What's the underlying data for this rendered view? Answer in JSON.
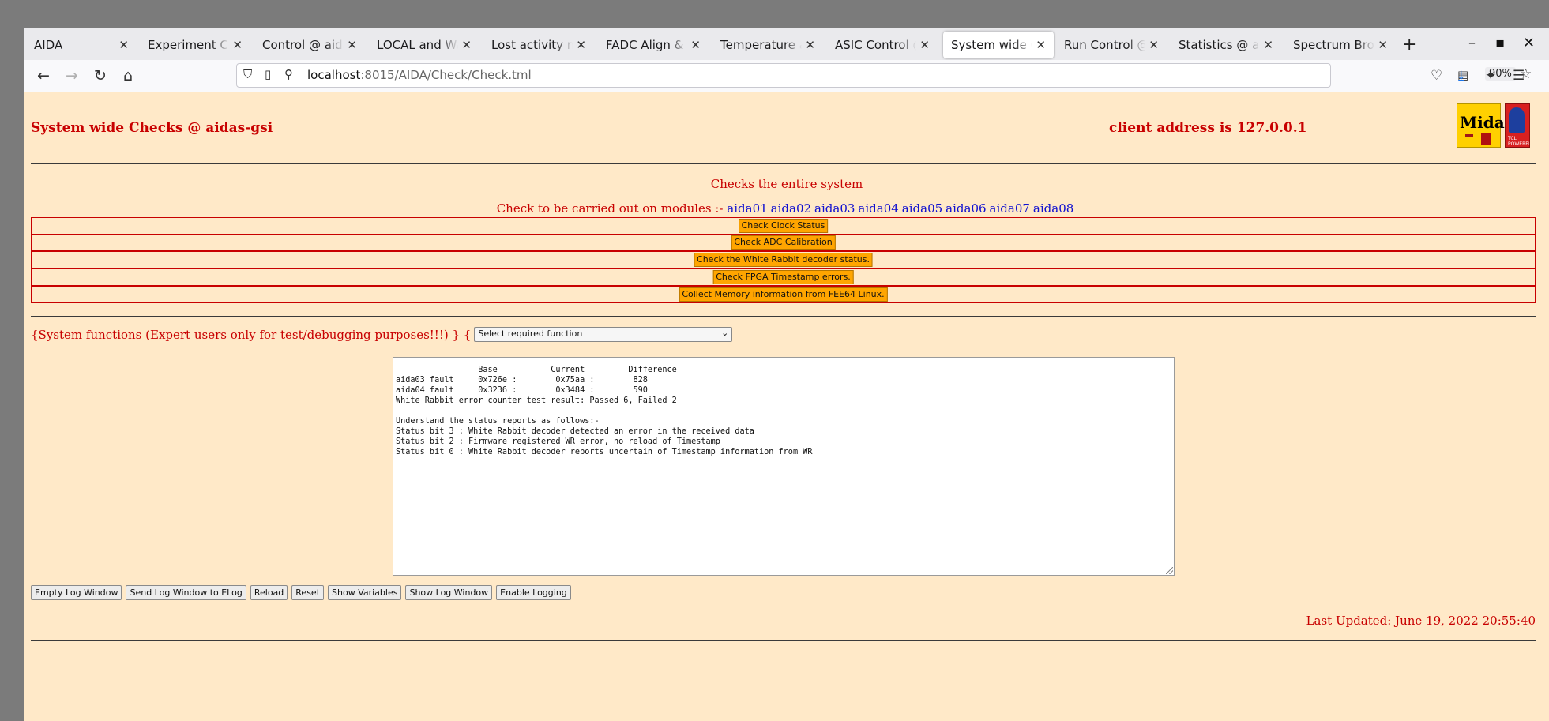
{
  "browser": {
    "tabs": [
      {
        "label": "AIDA",
        "active": false
      },
      {
        "label": "Experiment Control",
        "active": false
      },
      {
        "label": "Control @ aidas-gsi",
        "active": false
      },
      {
        "label": "LOCAL and Wave",
        "active": false
      },
      {
        "label": "Lost activity monitor",
        "active": false
      },
      {
        "label": "FADC Align & Control",
        "active": false
      },
      {
        "label": "Temperature and",
        "active": false
      },
      {
        "label": "ASIC Control @ aidas",
        "active": false
      },
      {
        "label": "System wide Checks",
        "active": true
      },
      {
        "label": "Run Control @ aidas",
        "active": false
      },
      {
        "label": "Statistics @ aidas",
        "active": false
      },
      {
        "label": "Spectrum Browser",
        "active": false
      }
    ],
    "new_tab": "+",
    "minimize": "–",
    "maximize": "▪",
    "close_window": "✕",
    "url_host": "localhost",
    "url_path": ":8015/AIDA/Check/Check.tml",
    "zoom": "90%"
  },
  "page": {
    "title": "System wide Checks @ aidas-gsi",
    "client_address": "client address is 127.0.0.1",
    "logo_text": "Midas",
    "logo2_text": "TCL POWERED",
    "intro": "Checks the entire system",
    "modules_prefix": "Check to be carried out on modules :-",
    "modules": [
      "aida01",
      "aida02",
      "aida03",
      "aida04",
      "aida05",
      "aida06",
      "aida07",
      "aida08"
    ],
    "checks": [
      "Check Clock Status",
      "Check ADC Calibration",
      "Check the White Rabbit decoder status.",
      "Check FPGA Timestamp errors.",
      "Collect Memory information from FEE64 Linux."
    ],
    "sysfunc_label": "{System functions (Expert users only for test/debugging purposes!!!)  } {",
    "select_value": "Select required function",
    "log_text": "                 Base           Current         Difference\naida03 fault     0x726e :        0x75aa :        828\naida04 fault     0x3236 :        0x3484 :        590\nWhite Rabbit error counter test result: Passed 6, Failed 2\n\nUnderstand the status reports as follows:-\nStatus bit 3 : White Rabbit decoder detected an error in the received data\nStatus bit 2 : Firmware registered WR error, no reload of Timestamp\nStatus bit 0 : White Rabbit decoder reports uncertain of Timestamp information from WR",
    "buttons": [
      "Empty Log Window",
      "Send Log Window to ELog",
      "Reload",
      "Reset",
      "Show Variables",
      "Show Log Window",
      "Enable Logging"
    ],
    "last_updated": "Last Updated: June 19, 2022 20:55:40"
  }
}
